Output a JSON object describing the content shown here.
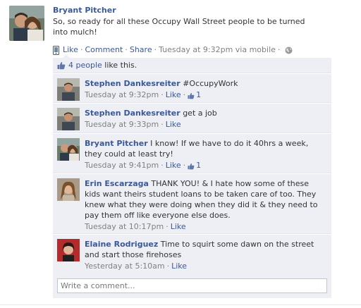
{
  "post": {
    "author": "Bryant Pitcher",
    "message": "So, so ready for all these Occupy Wall Street people to be turned into mulch!",
    "actions": {
      "like": "Like",
      "comment": "Comment",
      "share": "Share"
    },
    "separator": "·",
    "timestamp": "Tuesday at 9:32pm via mobile",
    "likes": {
      "count_label": "4 people",
      "suffix": " like this."
    }
  },
  "comments": [
    {
      "author": "Stephen Dankesreiter",
      "text": "#OccupyWork",
      "time": "Tuesday at 9:32pm",
      "like_label": "Like",
      "like_count": "1"
    },
    {
      "author": "Stephen Dankesreiter",
      "text": "get a job",
      "time": "Tuesday at 9:33pm",
      "like_label": "Like"
    },
    {
      "author": "Bryant Pitcher",
      "text": "I know! If we have to do it 40hrs a week, they could at least try!",
      "time": "Tuesday at 9:41pm",
      "like_label": "Like",
      "like_count": "1"
    },
    {
      "author": "Erin Escarzaga",
      "text": "THANK YOU! & I hate how some of these kids want theirs student loans to be taken care of too. They knew what they were doing when they did it & they need to pay them off like everyone else does.",
      "time": "Tuesday at 10:17pm",
      "like_label": "Like"
    },
    {
      "author": "Elaine Rodriguez",
      "text": "Time to squirt some dawn on the street and start those firehoses",
      "time": "Yesterday at 5:10am",
      "like_label": "Like"
    }
  ],
  "composer": {
    "placeholder": "Write a comment..."
  },
  "colors": {
    "link": "#3b5998",
    "ufi_background": "#edeff4",
    "meta_text": "#808080"
  }
}
